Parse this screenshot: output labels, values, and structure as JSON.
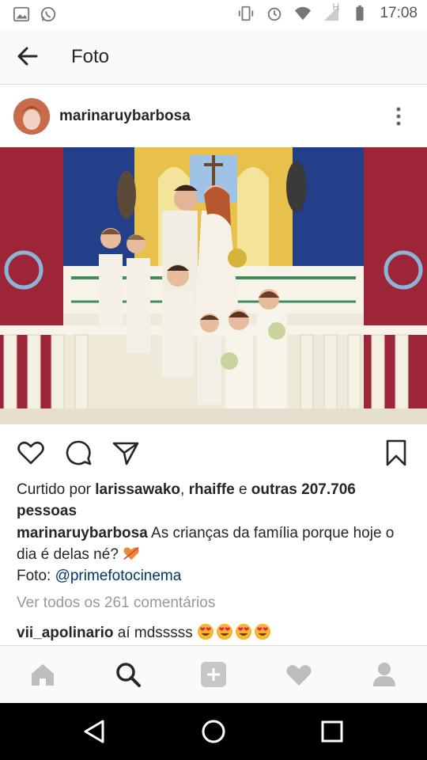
{
  "status_bar": {
    "time": "17:08",
    "network_label": "H",
    "icons": [
      "image-icon",
      "whatsapp-icon",
      "vibrate-icon",
      "alarm-icon",
      "wifi-icon",
      "signal-icon",
      "battery-icon"
    ]
  },
  "app_bar": {
    "title": "Foto",
    "back_icon": "arrow-left-icon"
  },
  "post": {
    "username": "marinaruybarbosa",
    "photo_alt": "wedding-photo",
    "likes": {
      "prefix": "Curtido por ",
      "user1": "larissawako",
      "sep": ", ",
      "user2": "rhaiffe",
      "mid": " e ",
      "others": "outras 207.706 pessoas"
    },
    "caption": {
      "username": "marinaruybarbosa",
      "text_line1": " As crianças da família porque hoje o dia é delas né?",
      "emoji_name": "orange-heart-arrow-icon",
      "credit_prefix": "Foto: ",
      "credit_link": "@primefotocinema"
    },
    "view_all_comments": "Ver todos os 261 comentários",
    "comment": {
      "username": "vii_apolinario",
      "text": " aí mdsssss",
      "emoji_name": "heart-eyes-emoji-icon",
      "emoji_count": 4
    }
  },
  "actions": [
    "heart-icon",
    "comment-icon",
    "share-icon",
    "bookmark-icon"
  ],
  "bottom_nav": [
    "home-icon",
    "search-icon",
    "add-icon",
    "activity-heart-icon",
    "profile-icon"
  ],
  "system_nav": [
    "back-triangle-icon",
    "home-circle-icon",
    "recents-square-icon"
  ],
  "colors": {
    "link": "#003569",
    "muted": "#999999",
    "text": "#262626",
    "emoji": "#f6b82f"
  }
}
